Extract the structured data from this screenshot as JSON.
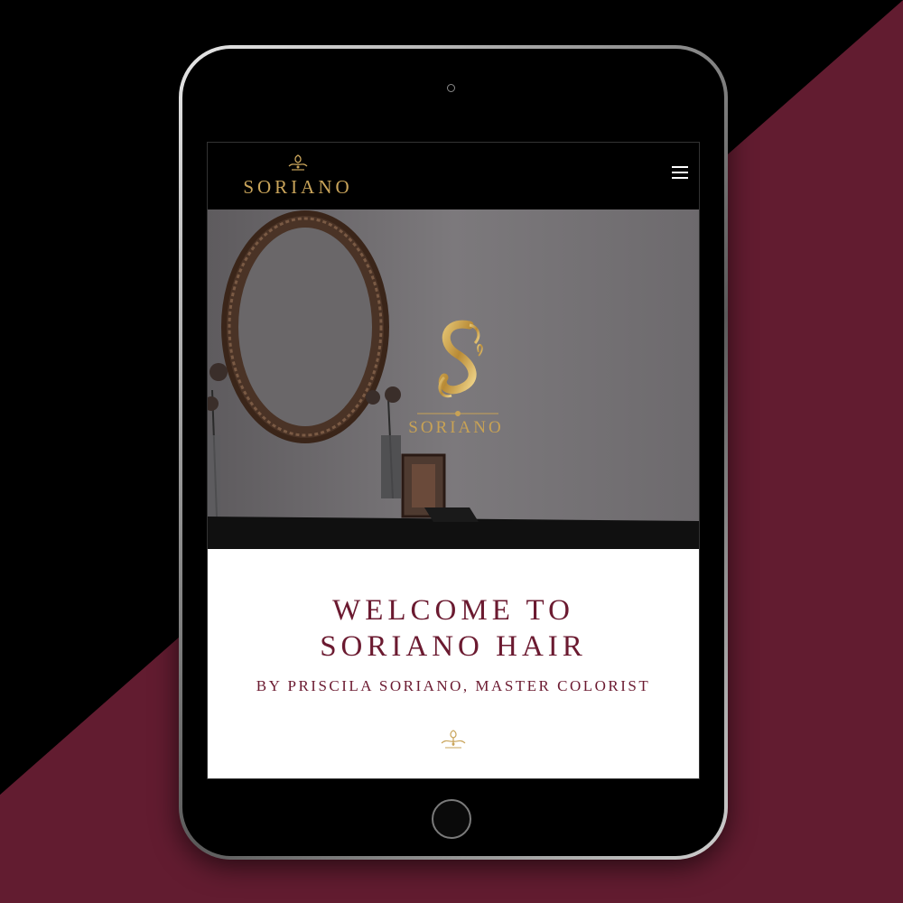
{
  "colors": {
    "maroon": "#621c30",
    "gold": "#c9a45a",
    "title": "#6b1a30"
  },
  "navbar": {
    "logo_text": "SORIANO",
    "menu_icon": "hamburger-menu-icon"
  },
  "hero": {
    "logo_text": "SORIANO"
  },
  "welcome": {
    "title_line1": "WELCOME TO",
    "title_line2": "SORIANO HAIR",
    "subtitle": "BY PRISCILA SORIANO, MASTER COLORIST",
    "ornament_icon": "crest-ornament-icon"
  }
}
